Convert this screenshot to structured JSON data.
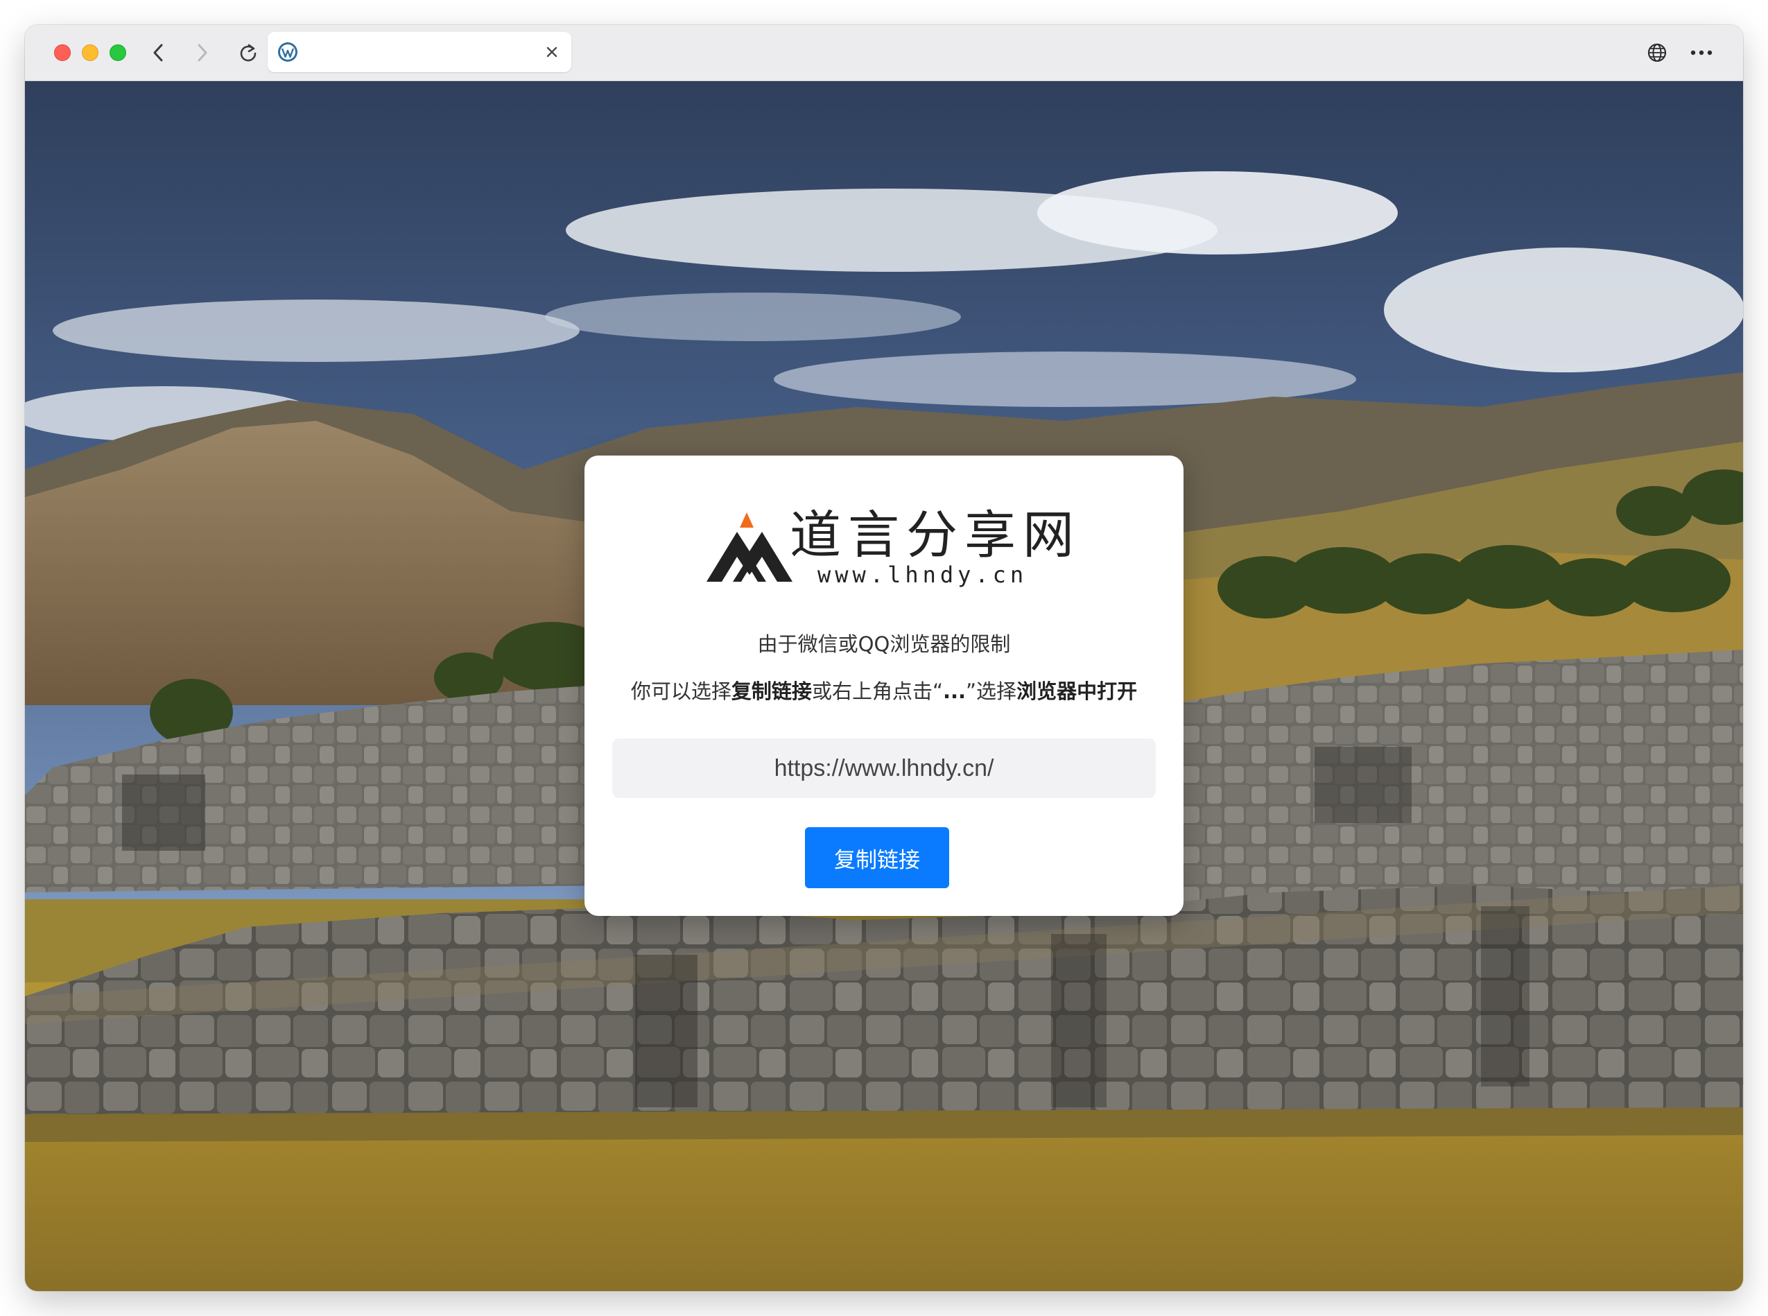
{
  "browser": {
    "tab": {
      "title": "",
      "favicon": "wordpress-icon"
    },
    "toolbar": {
      "back": "chevron-left-icon",
      "forward": "chevron-right-icon",
      "reload": "reload-icon",
      "globe": "globe-icon",
      "more": "more-icon"
    }
  },
  "logo": {
    "title": "道言分享网",
    "url": "www.lhndy.cn"
  },
  "message": {
    "line1": "由于微信或QQ浏览器的限制",
    "line2": [
      {
        "text": "你可以选择",
        "bold": false
      },
      {
        "text": "复制链接",
        "bold": true
      },
      {
        "text": "或右上角点击“",
        "bold": false
      },
      {
        "text": "...",
        "bold": true
      },
      {
        "text": "”选择",
        "bold": false
      },
      {
        "text": "浏览器中打开",
        "bold": true
      }
    ]
  },
  "link": {
    "value": "https://www.lhndy.cn/"
  },
  "button": {
    "copy_label": "复制链接"
  },
  "colors": {
    "accent": "#0a7bff",
    "logo_orange": "#f26b1d",
    "logo_dark": "#222222"
  }
}
